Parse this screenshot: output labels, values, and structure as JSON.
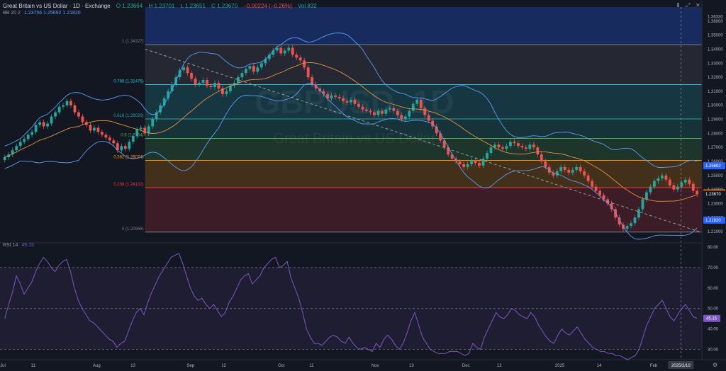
{
  "header": {
    "symbol": "Great Britain vs US Dollar · 1D · Exchange",
    "o": "O 1.23664",
    "h": "H 1.23701",
    "l": "L 1.23651",
    "c": "C 1.23670",
    "chg": "−0.00224 (−0.26%)",
    "vol": "Vol 832"
  },
  "bb_label": {
    "name": "BB 20 2",
    "values": "1.23756  1.25692  1.21820"
  },
  "rsi_label": {
    "name": "RSI 14",
    "value": "45.15"
  },
  "watermark": {
    "ticker": "GBPUSD, 1D",
    "name": "Great Britain vs US Dollar"
  },
  "icons": [
    "arrow-down-icon",
    "maximize-icon",
    "close-icon",
    "settings-icon"
  ],
  "colors": {
    "bg": "#131722",
    "up": "#26a69a",
    "down": "#ef5350",
    "bb": "#5b9cf6",
    "mid": "#e8913c",
    "rsi": "#7e57c2"
  },
  "chart_data": {
    "type": "candlestick",
    "price_axis": {
      "ylim": [
        1.205,
        1.37
      ],
      "ticks": [
        "1.36330",
        "1.36000",
        "1.35000",
        "1.34000",
        "1.33000",
        "1.32000",
        "1.31000",
        "1.30000",
        "1.29000",
        "1.28000",
        "1.27000",
        "1.26000",
        "1.25000",
        "1.24000",
        "1.23000",
        "1.22000",
        "1.21000"
      ],
      "tick_values": [
        1.3633,
        1.36,
        1.35,
        1.34,
        1.33,
        1.32,
        1.31,
        1.3,
        1.29,
        1.28,
        1.27,
        1.26,
        1.25,
        1.24,
        1.23,
        1.22,
        1.21
      ],
      "badges": [
        {
          "value": 1.25692,
          "label": "1.25692",
          "color": "#2962ff"
        },
        {
          "value": 1.23756,
          "label": "1.23756",
          "color": "#f57c00"
        },
        {
          "value": 1.2367,
          "label": "1.23670",
          "color": "#131722"
        },
        {
          "value": 1.2182,
          "label": "1.21820",
          "color": "#2962ff"
        }
      ]
    },
    "x_axis": {
      "ticks": [
        "Jul",
        "11",
        "Aug",
        "13",
        "Sep",
        "12",
        "Oct",
        "11",
        "Nov",
        "13",
        "Dec",
        "12",
        "2025",
        "14",
        "Feb"
      ],
      "tick_days": [
        0,
        10,
        31,
        43,
        62,
        73,
        92,
        102,
        123,
        135,
        153,
        164,
        184,
        197,
        215
      ],
      "cursor_label": "2025/2/10",
      "cursor_day": 224
    },
    "fib_levels": [
      {
        "ratio": "1",
        "label": "1 (1.34327)",
        "value": 1.34327,
        "color": "#787b86"
      },
      {
        "ratio": "0.786",
        "label": "0.786 (1.31476)",
        "value": 1.31476,
        "color": "#26c6da"
      },
      {
        "ratio": "0.618",
        "label": "0.618 (1.29029)",
        "value": 1.29029,
        "color": "#26a69a"
      },
      {
        "ratio": "0.5",
        "label": "0.5 (1.2764)",
        "value": 1.2764,
        "color": "#4caf50"
      },
      {
        "ratio": "0.382",
        "label": "0.382 (1.26074)",
        "value": 1.26074,
        "color": "#ff9800"
      },
      {
        "ratio": "0.236",
        "label": "0.236 (1.24132)",
        "value": 1.24132,
        "color": "#f23645"
      },
      {
        "ratio": "0",
        "label": "0 (1.20966)",
        "value": 1.20966,
        "color": "#787b86"
      }
    ],
    "trendline": {
      "from": [
        47,
        1.34
      ],
      "to": [
        230,
        1.21
      ]
    },
    "candles_close": [
      1.263,
      1.265,
      1.268,
      1.271,
      1.274,
      1.276,
      1.279,
      1.281,
      1.286,
      1.288,
      1.285,
      1.287,
      1.292,
      1.295,
      1.299,
      1.3,
      1.303,
      1.3,
      1.295,
      1.292,
      1.288,
      1.286,
      1.282,
      1.284,
      1.281,
      1.279,
      1.277,
      1.275,
      1.273,
      1.268,
      1.271,
      1.269,
      1.274,
      1.278,
      1.283,
      1.284,
      1.28,
      1.285,
      1.29,
      1.295,
      1.3,
      1.305,
      1.31,
      1.315,
      1.32,
      1.325,
      1.327,
      1.323,
      1.319,
      1.315,
      1.316,
      1.318,
      1.314,
      1.313,
      1.316,
      1.312,
      1.308,
      1.31,
      1.314,
      1.316,
      1.32,
      1.323,
      1.326,
      1.328,
      1.324,
      1.327,
      1.33,
      1.333,
      1.336,
      1.339,
      1.341,
      1.337,
      1.339,
      1.341,
      1.336,
      1.334,
      1.332,
      1.327,
      1.32,
      1.315,
      1.312,
      1.31,
      1.308,
      1.305,
      1.307,
      1.306,
      1.305,
      1.303,
      1.302,
      1.304,
      1.301,
      1.299,
      1.297,
      1.296,
      1.295,
      1.293,
      1.296,
      1.294,
      1.297,
      1.298,
      1.296,
      1.293,
      1.29,
      1.292,
      1.296,
      1.301,
      1.304,
      1.298,
      1.293,
      1.289,
      1.285,
      1.28,
      1.275,
      1.27,
      1.265,
      1.262,
      1.26,
      1.258,
      1.256,
      1.258,
      1.261,
      1.259,
      1.257,
      1.262,
      1.266,
      1.27,
      1.272,
      1.27,
      1.269,
      1.271,
      1.274,
      1.273,
      1.271,
      1.27,
      1.269,
      1.272,
      1.27,
      1.265,
      1.26,
      1.256,
      1.252,
      1.25,
      1.253,
      1.256,
      1.254,
      1.252,
      1.254,
      1.256,
      1.253,
      1.25,
      1.246,
      1.242,
      1.239,
      1.236,
      1.233,
      1.23,
      1.226,
      1.22,
      1.215,
      1.212,
      1.214,
      1.216,
      1.22,
      1.226,
      1.233,
      1.238,
      1.242,
      1.246,
      1.248,
      1.25,
      1.247,
      1.243,
      1.24,
      1.242,
      1.245,
      1.247,
      1.244,
      1.239,
      1.2367
    ],
    "rsi": {
      "ylim": [
        25,
        80
      ],
      "ticks": [
        "80.00",
        "70.00",
        "60.00",
        "50.00",
        "40.00",
        "30.00"
      ],
      "tick_values": [
        80,
        70,
        60,
        50,
        40,
        30
      ],
      "badge": {
        "value": 45.15,
        "label": "45.15"
      },
      "values": [
        45,
        52,
        58,
        66,
        62,
        57,
        60,
        63,
        68,
        72,
        75,
        73,
        70,
        68,
        71,
        73,
        74,
        68,
        60,
        54,
        50,
        47,
        44,
        43,
        41,
        39,
        37,
        35,
        34,
        31,
        33,
        34,
        39,
        44,
        48,
        50,
        47,
        53,
        58,
        62,
        66,
        69,
        72,
        75,
        76,
        77,
        72,
        66,
        60,
        56,
        54,
        55,
        52,
        50,
        52,
        49,
        46,
        48,
        53,
        56,
        60,
        64,
        66,
        67,
        62,
        64,
        66,
        70,
        72,
        74,
        75,
        70,
        71,
        73,
        65,
        60,
        55,
        48,
        40,
        36,
        33,
        33,
        32,
        34,
        36,
        37,
        36,
        34,
        33,
        36,
        33,
        31,
        30,
        31,
        30,
        29,
        33,
        31,
        35,
        37,
        35,
        32,
        30,
        33,
        38,
        44,
        48,
        42,
        36,
        33,
        30,
        29,
        28,
        28,
        28,
        29,
        29,
        29,
        28,
        27,
        28,
        33,
        31,
        30,
        36,
        40,
        44,
        48,
        46,
        45,
        47,
        50,
        49,
        47,
        46,
        45,
        48,
        46,
        42,
        39,
        36,
        34,
        33,
        37,
        40,
        38,
        37,
        39,
        41,
        38,
        35,
        33,
        31,
        30,
        29,
        29,
        28,
        28,
        27,
        27,
        26,
        25,
        26,
        27,
        30,
        36,
        42,
        46,
        50,
        52,
        54,
        50,
        46,
        44,
        47,
        50,
        52,
        49,
        46,
        45.15
      ]
    }
  }
}
